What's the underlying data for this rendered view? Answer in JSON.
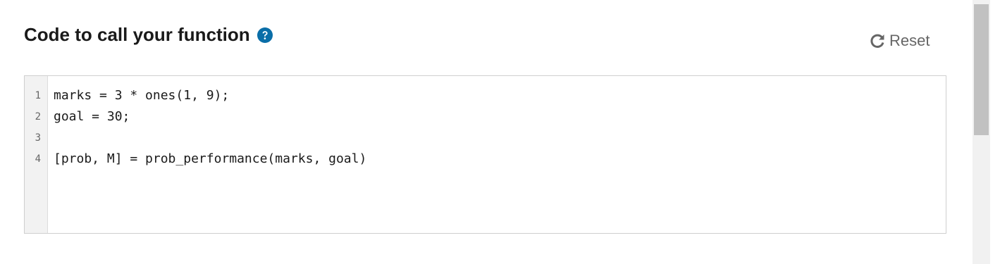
{
  "header": {
    "title": "Code to call your function",
    "help_icon": "question-circle-icon",
    "help_color": "#0a6ea8"
  },
  "toolbar": {
    "reset_label": "Reset",
    "reset_icon": "refresh-icon"
  },
  "editor": {
    "line_numbers": [
      "1",
      "2",
      "3",
      "4"
    ],
    "lines": [
      "marks = 3 * ones(1, 9);",
      "goal = 30;",
      "",
      "[prob, M] = prob_performance(marks, goal)"
    ]
  }
}
